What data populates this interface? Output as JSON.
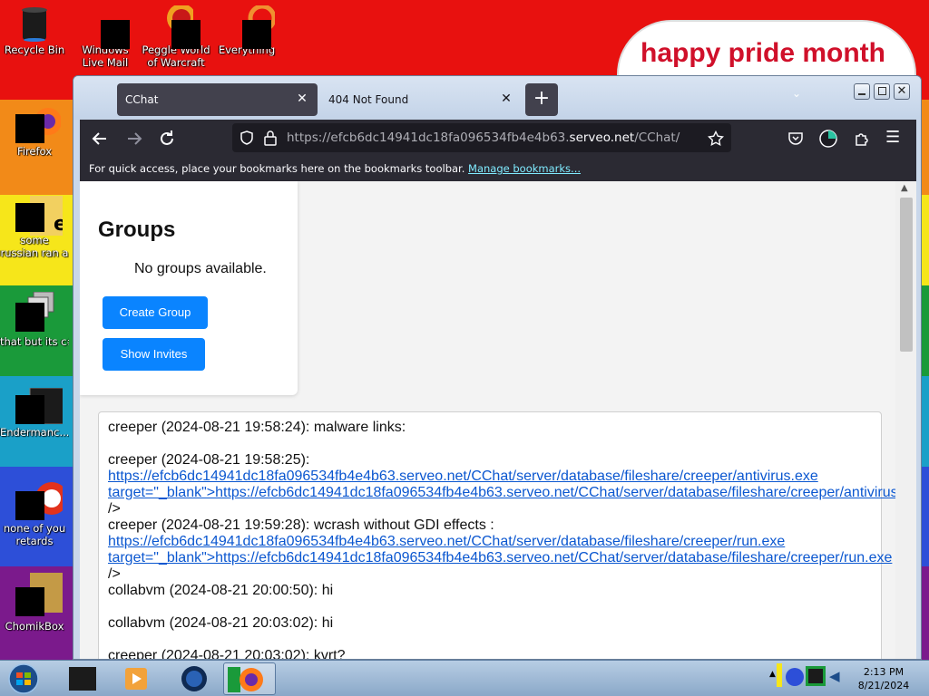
{
  "wallpaper": {
    "stripes": [
      "#e8110f",
      "#f28a18",
      "#f6e61a",
      "#1a9a3a",
      "#2d4fd8",
      "#7b1a8c"
    ],
    "banner_text": "happy pride month"
  },
  "desktop_icons": [
    {
      "name": "recycle-bin",
      "label": "Recycle Bin"
    },
    {
      "name": "windows-live-mail",
      "label": "Windows Live Mail"
    },
    {
      "name": "peggle-world-of-warcraft",
      "label": "Peggle World of Warcraft"
    },
    {
      "name": "everything",
      "label": "Everything"
    },
    {
      "name": "firefox",
      "label": "Firefox"
    },
    {
      "name": "some-russian-ran-a-rat",
      "label": "some russian ran a rat"
    },
    {
      "name": "that-but-its-c",
      "label": "that but its c#"
    },
    {
      "name": "endermanch",
      "label": "Endermanc..."
    },
    {
      "name": "none-of-you",
      "label": "none of you retards kno..."
    },
    {
      "name": "chomikbox",
      "label": "ChomikBox"
    }
  ],
  "browser": {
    "tabs": [
      {
        "label": "CChat",
        "active": true
      },
      {
        "label": "404 Not Found",
        "active": false
      }
    ],
    "new_tab_label": "+",
    "url_prefix": "https://",
    "url_domain_head": "efcb6dc14941dc18fa096534fb4e4b63.",
    "url_domain": "serveo.net",
    "url_path": "/CChat/",
    "bookmarks_hint": "For quick access, place your bookmarks here on the bookmarks toolbar.",
    "bookmarks_link": "Manage bookmarks..."
  },
  "page": {
    "groups_title": "Groups",
    "groups_empty": "No groups available.",
    "create_group": "Create Group",
    "show_invites": "Show Invites"
  },
  "chat": {
    "m1": "creeper (2024-08-21 19:58:24): malware links:",
    "m2_prefix": "creeper (2024-08-21 19:58:25): ",
    "m2_link1": "https://efcb6dc14941dc18fa096534fb4e4b63.serveo.net/CChat/server/database/fileshare/creeper/antivirus.exe target=\"_blank\">https://efcb6dc14941dc18fa096534fb4e4b63.serveo.net/CChat/server/database/fileshare/creeper/antivirus.exe",
    "m2_suffix": " />",
    "m3_prefix": "creeper (2024-08-21 19:59:28): wcrash without GDI effects : ",
    "m3_link": "https://efcb6dc14941dc18fa096534fb4e4b63.serveo.net/CChat/server/database/fileshare/creeper/run.exe target=\"_blank\">https://efcb6dc14941dc18fa096534fb4e4b63.serveo.net/CChat/server/database/fileshare/creeper/run.exe",
    "m3_suffix": " />",
    "m4": "collabvm (2024-08-21 20:00:50): hi",
    "m5": "collabvm (2024-08-21 20:03:02): hi",
    "m6": "creeper (2024-08-21 20:03:02): kvrt?"
  },
  "taskbar": {
    "time": "2:13 PM",
    "date": "8/21/2024"
  }
}
